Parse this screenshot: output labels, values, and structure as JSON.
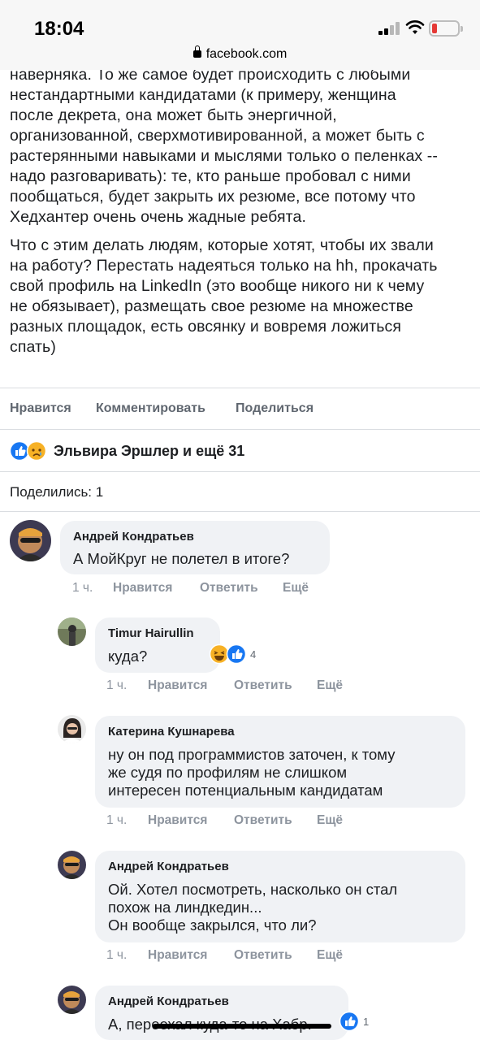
{
  "status_bar": {
    "time": "18:04",
    "url": "facebook.com"
  },
  "post": {
    "paragraph1": "наверняка. То же самое будет происходить с любыми\nнестандартными кандидатами (к примеру, женщина\nпосле декрета, она может быть энергичной,\nорганизованной, сверхмотивированной, а может быть с\nрастерянными навыками и мыслями только о пеленках --\nнадо разговаривать): те, кто раньше пробовал с ними\nпообщаться, будет закрыть их резюме, все потому что\nХедхантер очень очень жадные ребята.",
    "paragraph2": "Что с этим делать людям, которые хотят, чтобы их звали\nна работу? Перестать надеяться только на hh, прокачать\nсвой профиль на LinkedIn (это вообще никого ни к чему\nне обязывает), размещать свое резюме на множестве\nразных площадок, есть овсянку и вовремя ложиться\nспать)"
  },
  "actions": {
    "like": "Нравится",
    "comment": "Комментировать",
    "share": "Поделиться"
  },
  "reactions": {
    "names": "Эльвира Эршлер и ещё 31"
  },
  "shares": {
    "label": "Поделились: 1"
  },
  "comments": [
    {
      "author": "Андрей Кондратьев",
      "text": "А МойКруг не полетел в итоге?",
      "time": "1 ч.",
      "like": "Нравится",
      "reply": "Ответить",
      "more": "Ещё"
    },
    {
      "author": "Timur Hairullin",
      "text": "куда?",
      "time": "1 ч.",
      "like": "Нравится",
      "reply": "Ответить",
      "more": "Ещё",
      "reaction_count": "4"
    },
    {
      "author": "Катерина Кушнарева",
      "text": "ну он под программистов заточен, к тому\nже судя по профилям не слишком\nинтересен потенциальным кандидатам",
      "time": "1 ч.",
      "like": "Нравится",
      "reply": "Ответить",
      "more": "Ещё"
    },
    {
      "author": "Андрей Кондратьев",
      "text": "Ой. Хотел посмотреть, насколько он стал\nпохож на линдкедин...\nОн вообще закрылся, что ли?",
      "time": "1 ч.",
      "like": "Нравится",
      "reply": "Ответить",
      "more": "Ещё"
    },
    {
      "author": "Андрей Кондратьев",
      "text": "А, переехал куда-то на Хабр.",
      "reaction_count": "1"
    }
  ],
  "colors": {
    "like_blue": "#1877f2",
    "bubble_bg": "#f0f2f5",
    "meta_grey": "#8d949e",
    "battery_low": "#e53935"
  }
}
